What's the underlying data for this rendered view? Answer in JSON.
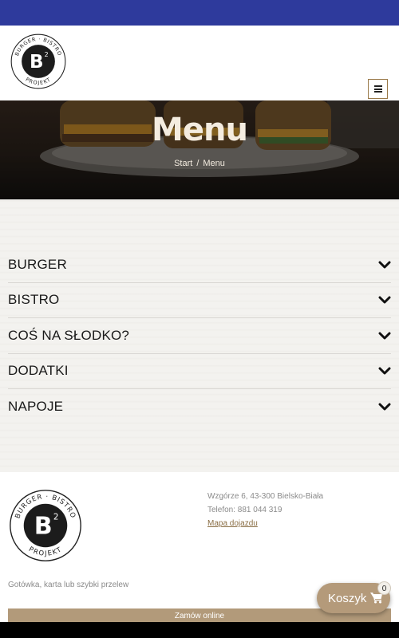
{
  "brand": {
    "ring_top": "BURGER · BISTRO",
    "ring_bottom": "PROJEKT",
    "letter": "B",
    "sup": "2",
    "colors": {
      "top_bar": "#2e3a9c",
      "accent": "#b49a7a",
      "outline": "#9a7a4a"
    }
  },
  "header": {
    "menu_icon": "hamburger-menu-icon"
  },
  "hero": {
    "title": "Menu",
    "breadcrumb": {
      "home": "Start",
      "separator": "/",
      "current": "Menu"
    }
  },
  "menu": {
    "sections": [
      {
        "label": "BURGER"
      },
      {
        "label": "BISTRO"
      },
      {
        "label": "COŚ NA SŁODKO?"
      },
      {
        "label": "DODATKI"
      },
      {
        "label": "NAPOJE"
      }
    ],
    "chevron_icon": "chevron-down-icon"
  },
  "footer": {
    "address": "Wzgórze 6, 43-300 Bielsko-Biała",
    "phone": "Telefon: 881 044 319",
    "map_link": "Mapa dojazdu",
    "payment": "Gotówka, karta lub szybki przelew",
    "order_button": "Zamów online"
  },
  "cart": {
    "label": "Koszyk",
    "count": "0",
    "icon": "shopping-cart-icon"
  }
}
